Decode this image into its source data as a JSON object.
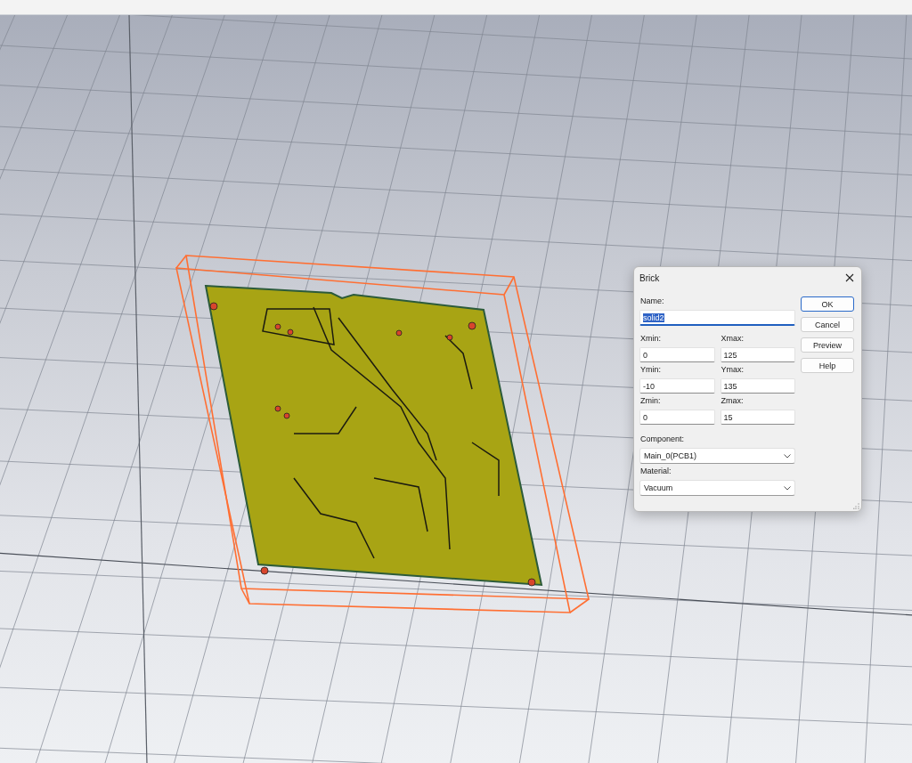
{
  "dialog": {
    "title": "Brick",
    "name": {
      "label": "Name:",
      "value": "solid2",
      "text_selected": true
    },
    "coordinates": [
      {
        "label": "Xmin:",
        "value": "0"
      },
      {
        "label": "Xmax:",
        "value": "125"
      },
      {
        "label": "Ymin:",
        "value": "-10"
      },
      {
        "label": "Ymax:",
        "value": "135"
      },
      {
        "label": "Zmin:",
        "value": "0"
      },
      {
        "label": "Zmax:",
        "value": "15"
      }
    ],
    "component": {
      "label": "Component:",
      "value": "Main_0(PCB1)"
    },
    "material": {
      "label": "Material:",
      "value": "Vacuum"
    },
    "buttons": [
      {
        "label": "OK",
        "default": true
      },
      {
        "label": "Cancel",
        "default": false
      },
      {
        "label": "Preview",
        "default": false
      },
      {
        "label": "Help",
        "default": false
      }
    ]
  }
}
